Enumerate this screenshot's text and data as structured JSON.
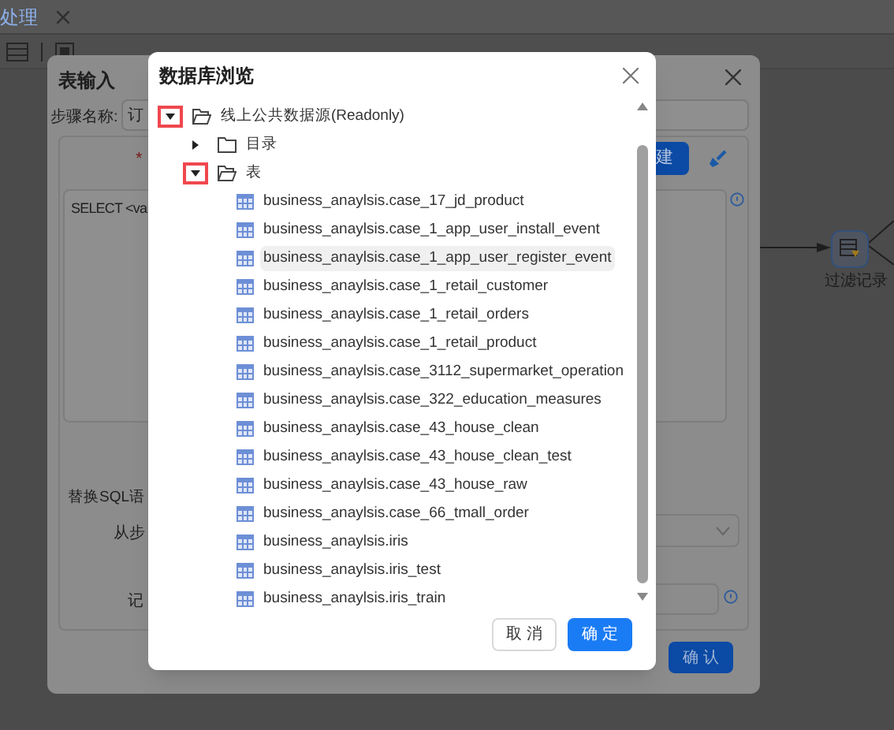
{
  "app_tab": {
    "label": "处理"
  },
  "canvas_node": {
    "label": "过滤记录"
  },
  "back_dialog": {
    "title": "表输入",
    "step_name_label": "步骤名称:",
    "step_name_value": "订",
    "required_mark": "*",
    "new_button": "建",
    "sql_text": "SELECT <va",
    "replace_label": "替换SQL语",
    "from_step_label": "从步",
    "record_label": "记",
    "confirm_button": "确 认"
  },
  "dialog": {
    "title": "数据库浏览",
    "tree": [
      {
        "label": "线上公共数据源(Readonly)",
        "kind": "folder",
        "expanded": true,
        "marked": true,
        "selected": false,
        "children": [
          {
            "label": "目录",
            "kind": "folder",
            "expanded": false,
            "marked": false,
            "selected": false
          },
          {
            "label": "表",
            "kind": "folder",
            "expanded": true,
            "marked": true,
            "selected": false,
            "children": [
              {
                "label": "business_anaylsis.case_17_jd_product",
                "kind": "table",
                "selected": false
              },
              {
                "label": "business_anaylsis.case_1_app_user_install_event",
                "kind": "table",
                "selected": false
              },
              {
                "label": "business_anaylsis.case_1_app_user_register_event",
                "kind": "table",
                "selected": true
              },
              {
                "label": "business_anaylsis.case_1_retail_customer",
                "kind": "table",
                "selected": false
              },
              {
                "label": "business_anaylsis.case_1_retail_orders",
                "kind": "table",
                "selected": false
              },
              {
                "label": "business_anaylsis.case_1_retail_product",
                "kind": "table",
                "selected": false
              },
              {
                "label": "business_anaylsis.case_3112_supermarket_operation",
                "kind": "table",
                "selected": false
              },
              {
                "label": "business_anaylsis.case_322_education_measures",
                "kind": "table",
                "selected": false
              },
              {
                "label": "business_anaylsis.case_43_house_clean",
                "kind": "table",
                "selected": false
              },
              {
                "label": "business_anaylsis.case_43_house_clean_test",
                "kind": "table",
                "selected": false
              },
              {
                "label": "business_anaylsis.case_43_house_raw",
                "kind": "table",
                "selected": false
              },
              {
                "label": "business_anaylsis.case_66_tmall_order",
                "kind": "table",
                "selected": false
              },
              {
                "label": "business_anaylsis.iris",
                "kind": "table",
                "selected": false
              },
              {
                "label": "business_anaylsis.iris_test",
                "kind": "table",
                "selected": false
              },
              {
                "label": "business_anaylsis.iris_train",
                "kind": "table",
                "selected": false
              }
            ]
          }
        ]
      }
    ],
    "buttons": [
      {
        "label": "取 消",
        "kind": "secondary"
      },
      {
        "label": "确 定",
        "kind": "primary"
      }
    ]
  }
}
